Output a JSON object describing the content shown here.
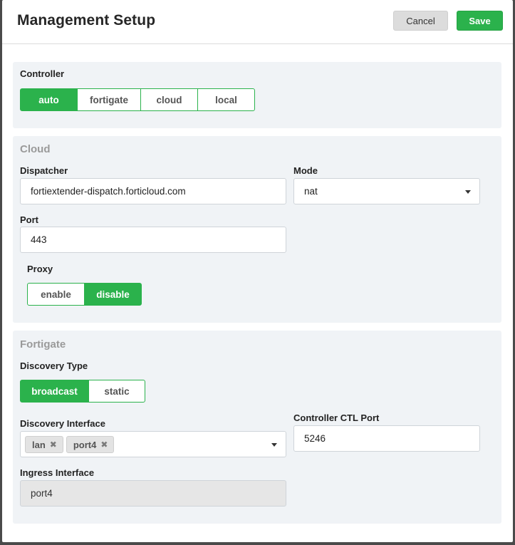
{
  "dialog": {
    "title": "Management Setup",
    "cancel_label": "Cancel",
    "save_label": "Save"
  },
  "controller": {
    "label": "Controller",
    "options": [
      "auto",
      "fortigate",
      "cloud",
      "local"
    ],
    "selected": "auto"
  },
  "cloud": {
    "section_title": "Cloud",
    "dispatcher_label": "Dispatcher",
    "dispatcher_value": "fortiextender-dispatch.forticloud.com",
    "mode_label": "Mode",
    "mode_value": "nat",
    "port_label": "Port",
    "port_value": "443",
    "proxy_label": "Proxy",
    "proxy_options": [
      "enable",
      "disable"
    ],
    "proxy_selected": "disable"
  },
  "fortigate": {
    "section_title": "Fortigate",
    "discovery_type_label": "Discovery Type",
    "discovery_type_options": [
      "broadcast",
      "static"
    ],
    "discovery_type_selected": "broadcast",
    "discovery_interface_label": "Discovery Interface",
    "discovery_interface_tags": [
      "lan",
      "port4"
    ],
    "remove_icon": "✖",
    "ctl_port_label": "Controller CTL Port",
    "ctl_port_value": "5246",
    "ingress_label": "Ingress Interface",
    "ingress_value": "port4"
  },
  "colors": {
    "accent": "#2bb24c",
    "section_bg": "#f0f3f6",
    "section_title": "#9a9a9a"
  }
}
